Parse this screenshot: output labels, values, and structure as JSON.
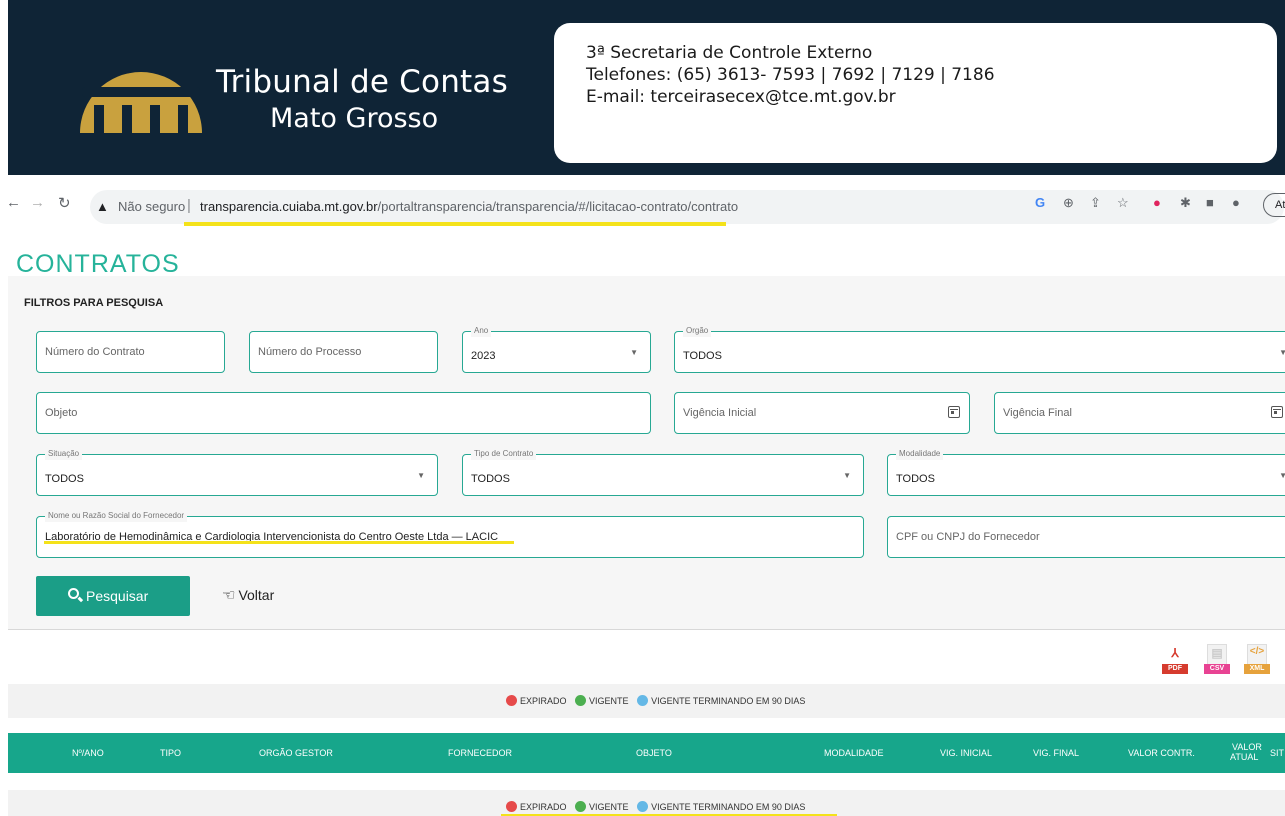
{
  "banner": {
    "org_line1": "Tribunal de Contas",
    "org_line2": "Mato Grosso",
    "contact_line1": "3ª Secretaria de Controle Externo",
    "contact_line2": "Telefones: (65) 3613- 7593 | 7692 | 7129 | 7186",
    "contact_line3": "E-mail: terceirasecex@tce.mt.gov.br"
  },
  "browser": {
    "security": "Não seguro",
    "url_host": "transparencia.cuiaba.mt.gov.br",
    "url_path": "/portaltransparencia/transparencia/#/licitacao-contrato/contrato",
    "update_label": "At"
  },
  "page": {
    "title": "CONTRATOS"
  },
  "filters": {
    "title": "FILTROS PARA PESQUISA",
    "numero_contrato_ph": "Número do Contrato",
    "numero_processo_ph": "Número do Processo",
    "ano_label": "Ano",
    "ano_value": "2023",
    "orgao_label": "Orgão",
    "orgao_value": "TODOS",
    "objeto_ph": "Objeto",
    "vig_inicial_ph": "Vigência Inicial",
    "vig_final_ph": "Vigência Final",
    "situacao_label": "Situação",
    "situacao_value": "TODOS",
    "tipo_label": "Tipo de Contrato",
    "tipo_value": "TODOS",
    "modalidade_label": "Modalidade",
    "modalidade_value": "TODOS",
    "fornecedor_label": "Nome ou Razão Social do Fornecedor",
    "fornecedor_value": "Laboratório de Hemodinâmica e Cardiologia Intervencionista do Centro Oeste Ltda — LACIC",
    "cpf_ph": "CPF ou CNPJ do Fornecedor",
    "search_label": "Pesquisar",
    "back_label": "Voltar"
  },
  "exports": {
    "pdf": "PDF",
    "csv": "CSV",
    "xml": "XML"
  },
  "legend": {
    "expirado": "EXPIRADO",
    "vigente": "VIGENTE",
    "terminando": "VIGENTE TERMINANDO EM 90 DIAS"
  },
  "colors": {
    "expirado": "#e64a4a",
    "vigente": "#4caf50",
    "terminando": "#64b8e6",
    "accent": "#17a68b"
  },
  "table": {
    "headers": [
      "Nº/ANO",
      "TIPO",
      "ORGÃO GESTOR",
      "FORNECEDOR",
      "OBJETO",
      "MODALIDADE",
      "VIG. INICIAL",
      "VIG. FINAL",
      "VALOR CONTR.",
      "VALOR",
      "ATUAL",
      "SIT"
    ]
  }
}
